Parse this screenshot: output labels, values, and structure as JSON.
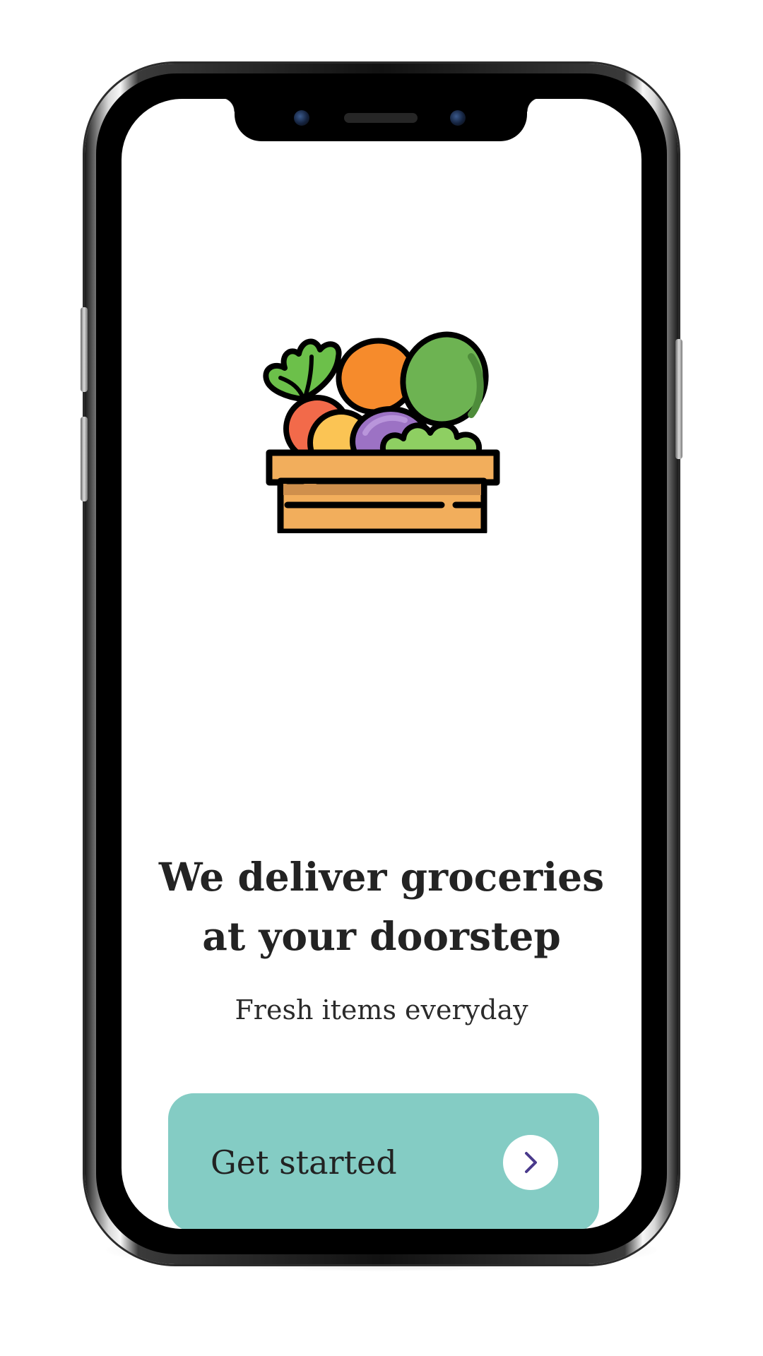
{
  "onboarding": {
    "headline_line1": "We deliver groceries",
    "headline_line2": "at your doorstep",
    "subtitle": "Fresh items everyday",
    "cta_label": "Get started",
    "illustration_icon": "grocery-crate-icon",
    "cta_icon": "chevron-right-icon"
  },
  "colors": {
    "cta_background": "#84ccc4",
    "cta_arrow": "#4a3a8c",
    "text": "#232323",
    "crate": "#f2ae5c"
  }
}
